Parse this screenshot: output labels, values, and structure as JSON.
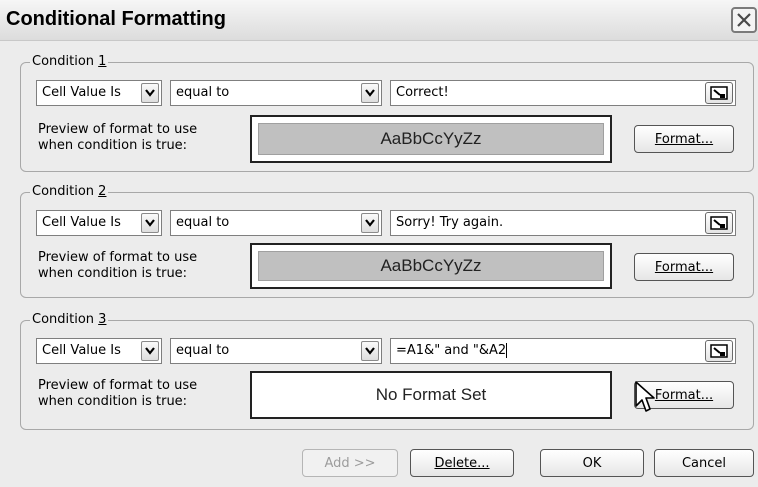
{
  "dialog": {
    "title": "Conditional Formatting",
    "close_symbol": "X"
  },
  "conditions": [
    {
      "legend_prefix": "Condition ",
      "legend_number": "1",
      "type_value": "Cell Value Is",
      "operator_value": "equal to",
      "formula_value": "Correct!",
      "preview_label": "Preview of format to use when condition is true:",
      "preview_text": "AaBbCcYyZz",
      "preview_has_format": true,
      "format_button_label": "Format..."
    },
    {
      "legend_prefix": "Condition ",
      "legend_number": "2",
      "type_value": "Cell Value Is",
      "operator_value": "equal to",
      "formula_value": "Sorry! Try again.",
      "preview_label": "Preview of format to use when condition is true:",
      "preview_text": "AaBbCcYyZz",
      "preview_has_format": true,
      "format_button_label": "Format..."
    },
    {
      "legend_prefix": "Condition ",
      "legend_number": "3",
      "type_value": "Cell Value Is",
      "operator_value": "equal to",
      "formula_value": "=A1&\" and \"&A2",
      "preview_label": "Preview of format to use when condition is true:",
      "preview_text": "No Format Set",
      "preview_has_format": false,
      "format_button_label": "Format..."
    }
  ],
  "footer": {
    "add_label": "Add >>",
    "add_enabled": false,
    "delete_label": "Delete...",
    "ok_label": "OK",
    "cancel_label": "Cancel"
  },
  "icons": {
    "close": "close-icon",
    "dropdown": "chevron-down-icon",
    "range_selector": "collapse-dialog-icon",
    "cursor": "mouse-pointer-icon"
  },
  "colors": {
    "preview_fill": "#c0c0c0",
    "dialog_background": "#ececec"
  }
}
